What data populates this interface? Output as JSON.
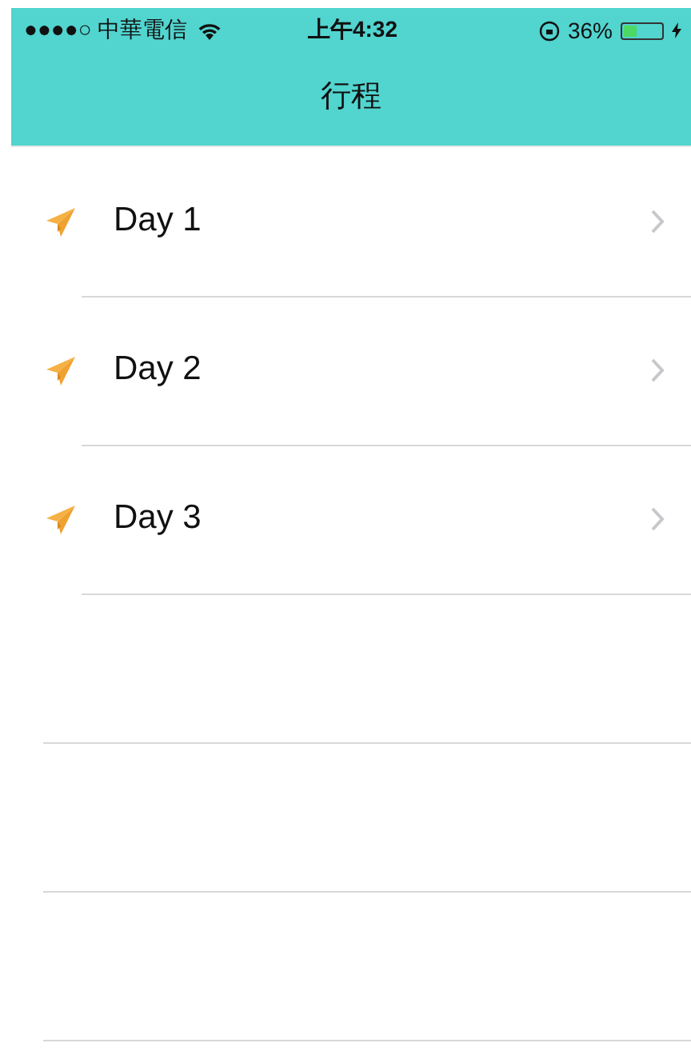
{
  "status_bar": {
    "carrier": "●●●●○ 中華電信",
    "time": "上午4:32",
    "battery_text": "36%",
    "battery": {
      "level": 0.36
    }
  },
  "nav": {
    "title": "行程"
  },
  "days": [
    {
      "label": "Day 1"
    },
    {
      "label": "Day 2"
    },
    {
      "label": "Day 3"
    }
  ]
}
